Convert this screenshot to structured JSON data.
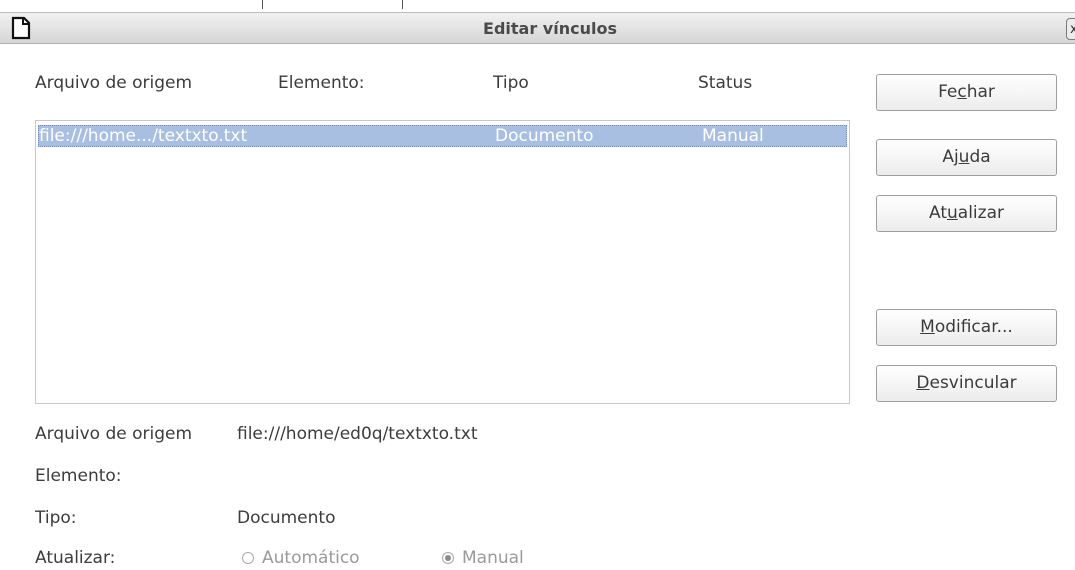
{
  "window": {
    "title": "Editar vínculos",
    "close_label": "x"
  },
  "list": {
    "headers": [
      "Arquivo de origem",
      "Elemento:",
      "Tipo",
      "Status"
    ],
    "rows": [
      {
        "source": "file:///home.../textxto.txt",
        "element": "",
        "type": "Documento",
        "status": "Manual",
        "selected": true
      }
    ]
  },
  "buttons": {
    "close": {
      "pre": "Fe",
      "key": "c",
      "post": "har"
    },
    "help": {
      "pre": "Aj",
      "key": "u",
      "post": "da"
    },
    "update": {
      "pre": "At",
      "key": "u",
      "post": "alizar"
    },
    "modify": {
      "pre": "",
      "key": "M",
      "post": "odificar..."
    },
    "unlink": {
      "pre": "",
      "key": "D",
      "post": "esvincular"
    }
  },
  "details": {
    "source_label": "Arquivo de origem",
    "source_value": "file:///home/ed0q/textxto.txt",
    "element_label": "Elemento:",
    "element_value": "",
    "type_label": "Tipo:",
    "type_value": "Documento",
    "update_label": "Atualizar:",
    "update_options": [
      {
        "label": "Automático",
        "selected": false,
        "enabled": false
      },
      {
        "label": "Manual",
        "selected": true,
        "enabled": false
      }
    ]
  },
  "colors": {
    "selection": "#a8bfe2",
    "selection_text": "#ffffff"
  },
  "icons": {
    "app": "document-icon",
    "close": "close-icon"
  }
}
